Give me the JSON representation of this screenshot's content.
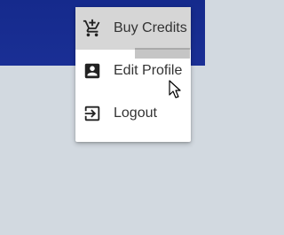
{
  "colors": {
    "app_bar": "#152a8c",
    "background": "#d2d9e0",
    "menu_hover": "#d6d6d6",
    "text": "#333333"
  },
  "menu": {
    "items": [
      {
        "label": "Buy Credits",
        "icon": "add-shopping-cart-icon",
        "hovered": true
      },
      {
        "label": "Edit Profile",
        "icon": "account-box-icon",
        "hovered": false
      },
      {
        "label": "Logout",
        "icon": "exit-to-app-icon",
        "hovered": false
      }
    ]
  }
}
